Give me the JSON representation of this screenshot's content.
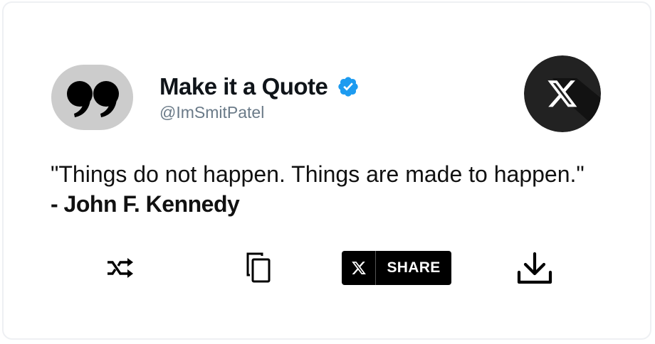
{
  "header": {
    "name": "Make it a Quote",
    "handle": "@ImSmitPatel",
    "verified": true,
    "avatar_icon": "quote-mark-icon",
    "platform_icon": "x-logo-icon"
  },
  "quote": {
    "text": "\"Things do not happen. Things are made to happen.\"",
    "author": "- John F. Kennedy"
  },
  "actions": {
    "shuffle_icon": "shuffle-icon",
    "copy_icon": "copy-icon",
    "share_label": "SHARE",
    "download_icon": "download-icon"
  },
  "colors": {
    "verified_blue": "#1d9bf0",
    "handle_gray": "#6a7a88",
    "avatar_bg": "#cccccc",
    "x_logo_bg": "#222222",
    "share_bg": "#000000"
  }
}
